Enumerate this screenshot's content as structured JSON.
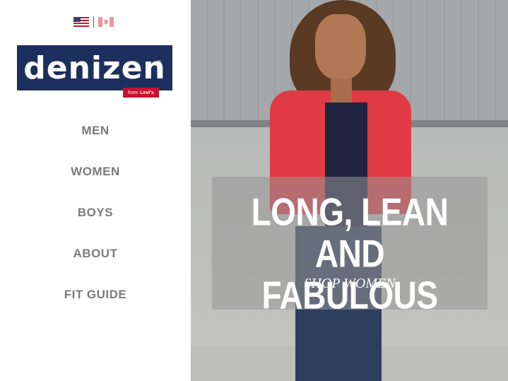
{
  "brand": {
    "name": "denizen",
    "registered_mark": "®",
    "sub_brand_from": "from",
    "sub_brand_name": "Levi's"
  },
  "flags": {
    "us_icon": "us-flag-icon",
    "ca_icon": "canada-flag-icon"
  },
  "nav": {
    "items": [
      {
        "label": "MEN"
      },
      {
        "label": "WOMEN"
      },
      {
        "label": "BOYS"
      },
      {
        "label": "ABOUT"
      },
      {
        "label": "FIT GUIDE"
      }
    ]
  },
  "hero": {
    "headline": "LONG, LEAN AND FABULOUS",
    "cta": "SHOP WOMEN"
  },
  "colors": {
    "brand_navy": "#1c2f5f",
    "levis_red": "#c8102e",
    "nav_gray": "#7a7a7a",
    "jacket_red": "#e03a44"
  }
}
